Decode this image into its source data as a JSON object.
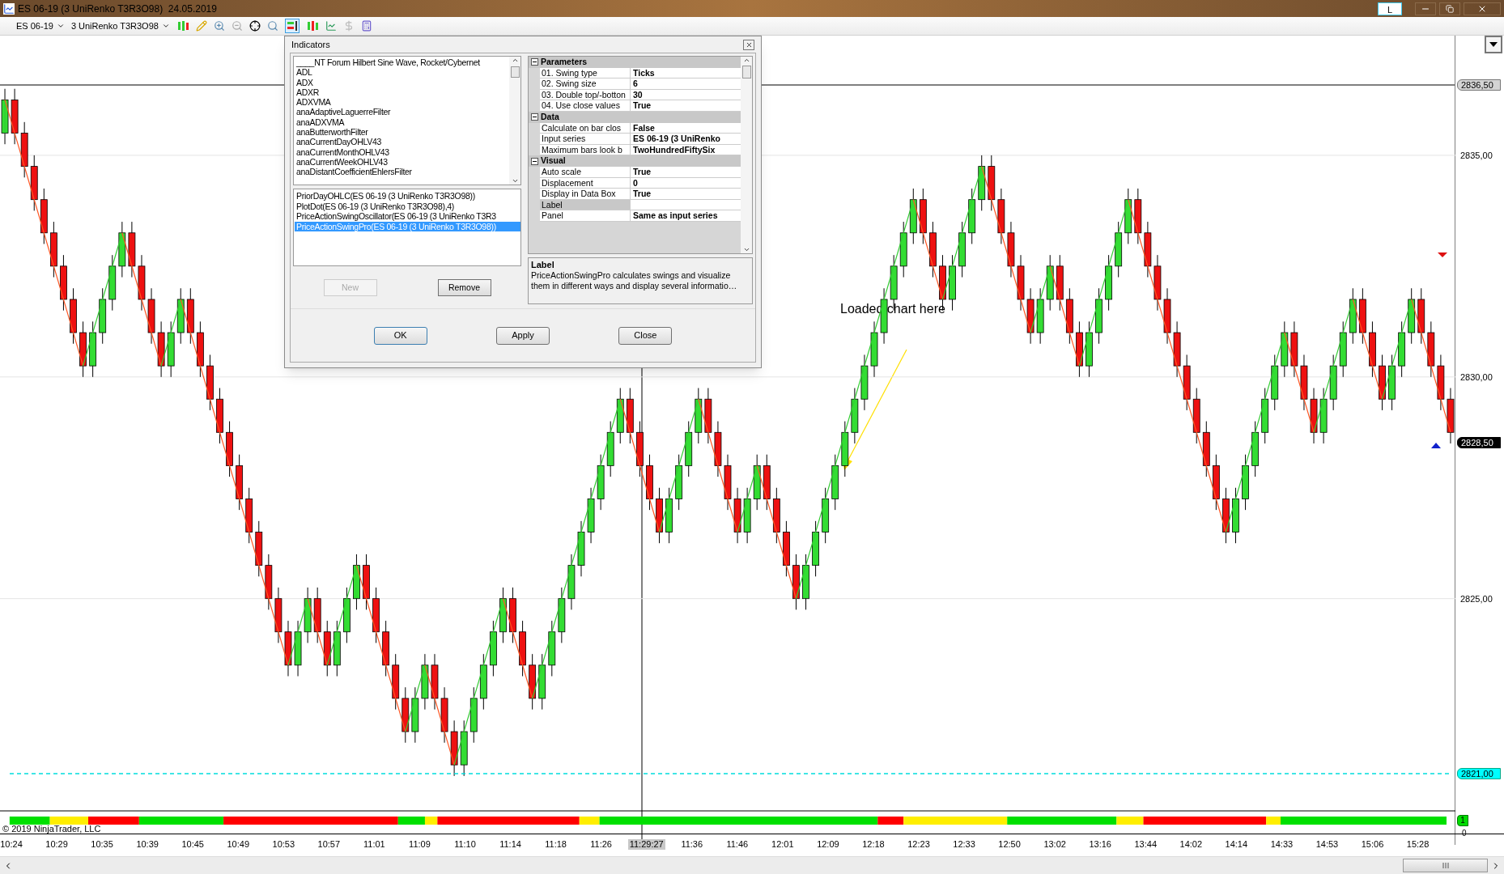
{
  "window": {
    "title": "ES 06-19 (3 UniRenko T3R3O98)  24.05.2019",
    "layout_button": "L"
  },
  "toolbar": {
    "instrument": "ES 06-19",
    "bar_type": "3 UniRenko T3R3O98"
  },
  "chart": {
    "chart_data": {
      "type": "candlestick",
      "ylim": [
        2819.5,
        2837.7
      ],
      "grid": true,
      "yticks": [
        {
          "value": 2835,
          "label": "2835,00"
        },
        {
          "value": 2830,
          "label": "2830,00"
        },
        {
          "value": 2825,
          "label": "2825,00"
        }
      ],
      "ohlc": [
        [
          2835.5,
          2836.5,
          2835.25,
          2836.25
        ],
        [
          2836.25,
          2836.5,
          2835.25,
          2835.5
        ],
        [
          2835.5,
          2835.75,
          2834.5,
          2834.75
        ],
        [
          2834.75,
          2835,
          2833.75,
          2834
        ],
        [
          2834,
          2834.25,
          2833,
          2833.25
        ],
        [
          2833.25,
          2833.5,
          2832.25,
          2832.5
        ],
        [
          2832.5,
          2832.75,
          2831.5,
          2831.75
        ],
        [
          2831.75,
          2832,
          2830.75,
          2831
        ],
        [
          2831,
          2831.25,
          2830,
          2830.25
        ],
        [
          2830.25,
          2831.25,
          2830,
          2831
        ],
        [
          2831,
          2832,
          2830.75,
          2831.75
        ],
        [
          2831.75,
          2832.75,
          2831.5,
          2832.5
        ],
        [
          2832.5,
          2833.5,
          2832.25,
          2833.25
        ],
        [
          2833.25,
          2833.5,
          2832.25,
          2832.5
        ],
        [
          2832.5,
          2832.75,
          2831.5,
          2831.75
        ],
        [
          2831.75,
          2832,
          2830.75,
          2831
        ],
        [
          2831,
          2831.25,
          2830,
          2830.25
        ],
        [
          2830.25,
          2831.25,
          2830,
          2831
        ],
        [
          2831,
          2832,
          2830.75,
          2831.75
        ],
        [
          2831.75,
          2832,
          2830.75,
          2831
        ],
        [
          2831,
          2831.25,
          2830,
          2830.25
        ],
        [
          2830.25,
          2830.5,
          2829.25,
          2829.5
        ],
        [
          2829.5,
          2829.75,
          2828.5,
          2828.75
        ],
        [
          2828.75,
          2829,
          2827.75,
          2828
        ],
        [
          2828,
          2828.25,
          2827,
          2827.25
        ],
        [
          2827.25,
          2827.5,
          2826.25,
          2826.5
        ],
        [
          2826.5,
          2826.75,
          2825.5,
          2825.75
        ],
        [
          2825.75,
          2826,
          2824.75,
          2825
        ],
        [
          2825,
          2825.25,
          2824,
          2824.25
        ],
        [
          2824.25,
          2824.5,
          2823.25,
          2823.5
        ],
        [
          2823.5,
          2824.5,
          2823.25,
          2824.25
        ],
        [
          2824.25,
          2825.25,
          2824,
          2825
        ],
        [
          2825,
          2825.25,
          2824,
          2824.25
        ],
        [
          2824.25,
          2824.5,
          2823.25,
          2823.5
        ],
        [
          2823.5,
          2824.5,
          2823.25,
          2824.25
        ],
        [
          2824.25,
          2825.25,
          2824,
          2825
        ],
        [
          2825,
          2826,
          2824.75,
          2825.75
        ],
        [
          2825.75,
          2826,
          2824.75,
          2825
        ],
        [
          2825,
          2825.25,
          2824,
          2824.25
        ],
        [
          2824.25,
          2824.5,
          2823.25,
          2823.5
        ],
        [
          2823.5,
          2823.75,
          2822.5,
          2822.75
        ],
        [
          2822.75,
          2823,
          2821.75,
          2822
        ],
        [
          2822,
          2823,
          2821.75,
          2822.75
        ],
        [
          2822.75,
          2823.75,
          2822.5,
          2823.5
        ],
        [
          2823.5,
          2823.75,
          2822.5,
          2822.75
        ],
        [
          2822.75,
          2823,
          2821.75,
          2822
        ],
        [
          2822,
          2822.25,
          2821,
          2821.25
        ],
        [
          2821.25,
          2822.25,
          2821,
          2822
        ],
        [
          2822,
          2823,
          2821.75,
          2822.75
        ],
        [
          2822.75,
          2823.75,
          2822.5,
          2823.5
        ],
        [
          2823.5,
          2824.5,
          2823.25,
          2824.25
        ],
        [
          2824.25,
          2825.25,
          2824,
          2825
        ],
        [
          2825,
          2825.25,
          2824,
          2824.25
        ],
        [
          2824.25,
          2824.5,
          2823.25,
          2823.5
        ],
        [
          2823.5,
          2823.75,
          2822.5,
          2822.75
        ],
        [
          2822.75,
          2823.75,
          2822.5,
          2823.5
        ],
        [
          2823.5,
          2824.5,
          2823.25,
          2824.25
        ],
        [
          2824.25,
          2825.25,
          2824,
          2825
        ],
        [
          2825,
          2826,
          2824.75,
          2825.75
        ],
        [
          2825.75,
          2826.75,
          2825.5,
          2826.5
        ],
        [
          2826.5,
          2827.5,
          2826.25,
          2827.25
        ],
        [
          2827.25,
          2828.25,
          2827,
          2828
        ],
        [
          2828,
          2829,
          2827.75,
          2828.75
        ],
        [
          2828.75,
          2829.75,
          2828.5,
          2829.5
        ],
        [
          2829.5,
          2829.75,
          2828.5,
          2828.75
        ],
        [
          2828.75,
          2829,
          2827.75,
          2828
        ],
        [
          2828,
          2828.25,
          2827,
          2827.25
        ],
        [
          2827.25,
          2827.5,
          2826.25,
          2826.5
        ],
        [
          2826.5,
          2827.5,
          2826.25,
          2827.25
        ],
        [
          2827.25,
          2828.25,
          2827,
          2828
        ],
        [
          2828,
          2829,
          2827.75,
          2828.75
        ],
        [
          2828.75,
          2829.75,
          2828.5,
          2829.5
        ],
        [
          2829.5,
          2829.75,
          2828.5,
          2828.75
        ],
        [
          2828.75,
          2829,
          2827.75,
          2828
        ],
        [
          2828,
          2828.25,
          2827,
          2827.25
        ],
        [
          2827.25,
          2827.5,
          2826.25,
          2826.5
        ],
        [
          2826.5,
          2827.5,
          2826.25,
          2827.25
        ],
        [
          2827.25,
          2828.25,
          2827,
          2828
        ],
        [
          2828,
          2828.25,
          2827,
          2827.25
        ],
        [
          2827.25,
          2827.5,
          2826.25,
          2826.5
        ],
        [
          2826.5,
          2826.75,
          2825.5,
          2825.75
        ],
        [
          2825.75,
          2826,
          2824.75,
          2825
        ],
        [
          2825,
          2826,
          2824.75,
          2825.75
        ],
        [
          2825.75,
          2826.75,
          2825.5,
          2826.5
        ],
        [
          2826.5,
          2827.5,
          2826.25,
          2827.25
        ],
        [
          2827.25,
          2828.25,
          2827,
          2828
        ],
        [
          2828,
          2829,
          2827.75,
          2828.75
        ],
        [
          2828.75,
          2829.75,
          2828.5,
          2829.5
        ],
        [
          2829.5,
          2830.5,
          2829.25,
          2830.25
        ],
        [
          2830.25,
          2831.25,
          2830,
          2831
        ],
        [
          2831,
          2832,
          2830.75,
          2831.75
        ],
        [
          2831.75,
          2832.75,
          2831.5,
          2832.5
        ],
        [
          2832.5,
          2833.5,
          2832.25,
          2833.25
        ],
        [
          2833.25,
          2834.25,
          2833,
          2834
        ],
        [
          2834,
          2834.25,
          2833,
          2833.25
        ],
        [
          2833.25,
          2833.5,
          2832.25,
          2832.5
        ],
        [
          2832.5,
          2832.75,
          2831.5,
          2831.75
        ],
        [
          2831.75,
          2832.75,
          2831.5,
          2832.5
        ],
        [
          2832.5,
          2833.5,
          2832.25,
          2833.25
        ],
        [
          2833.25,
          2834.25,
          2833,
          2834
        ],
        [
          2834,
          2835,
          2833.75,
          2834.75
        ],
        [
          2834.75,
          2835,
          2833.75,
          2834
        ],
        [
          2834,
          2834.25,
          2833,
          2833.25
        ],
        [
          2833.25,
          2833.5,
          2832.25,
          2832.5
        ],
        [
          2832.5,
          2832.75,
          2831.5,
          2831.75
        ],
        [
          2831.75,
          2832,
          2830.75,
          2831
        ],
        [
          2831,
          2832,
          2830.75,
          2831.75
        ],
        [
          2831.75,
          2832.75,
          2831.5,
          2832.5
        ],
        [
          2832.5,
          2832.75,
          2831.5,
          2831.75
        ],
        [
          2831.75,
          2832,
          2830.75,
          2831
        ],
        [
          2831,
          2831.25,
          2830,
          2830.25
        ],
        [
          2830.25,
          2831.25,
          2830,
          2831
        ],
        [
          2831,
          2832,
          2830.75,
          2831.75
        ],
        [
          2831.75,
          2832.75,
          2831.5,
          2832.5
        ],
        [
          2832.5,
          2833.5,
          2832.25,
          2833.25
        ],
        [
          2833.25,
          2834.25,
          2833,
          2834
        ],
        [
          2834,
          2834.25,
          2833,
          2833.25
        ],
        [
          2833.25,
          2833.5,
          2832.25,
          2832.5
        ],
        [
          2832.5,
          2832.75,
          2831.5,
          2831.75
        ],
        [
          2831.75,
          2832,
          2830.75,
          2831
        ],
        [
          2831,
          2831.25,
          2830,
          2830.25
        ],
        [
          2830.25,
          2830.5,
          2829.25,
          2829.5
        ],
        [
          2829.5,
          2829.75,
          2828.5,
          2828.75
        ],
        [
          2828.75,
          2829,
          2827.75,
          2828
        ],
        [
          2828,
          2828.25,
          2827,
          2827.25
        ],
        [
          2827.25,
          2827.5,
          2826.25,
          2826.5
        ],
        [
          2826.5,
          2827.5,
          2826.25,
          2827.25
        ],
        [
          2827.25,
          2828.25,
          2827,
          2828
        ],
        [
          2828,
          2829,
          2827.75,
          2828.75
        ],
        [
          2828.75,
          2829.75,
          2828.5,
          2829.5
        ],
        [
          2829.5,
          2830.5,
          2829.25,
          2830.25
        ],
        [
          2830.25,
          2831.25,
          2830,
          2831
        ],
        [
          2831,
          2831.25,
          2830,
          2830.25
        ],
        [
          2830.25,
          2830.5,
          2829.25,
          2829.5
        ],
        [
          2829.5,
          2829.75,
          2828.5,
          2828.75
        ],
        [
          2828.75,
          2829.75,
          2828.5,
          2829.5
        ],
        [
          2829.5,
          2830.5,
          2829.25,
          2830.25
        ],
        [
          2830.25,
          2831.25,
          2830,
          2831
        ],
        [
          2831,
          2832,
          2830.75,
          2831.75
        ],
        [
          2831.75,
          2832,
          2830.75,
          2831
        ],
        [
          2831,
          2831.25,
          2830,
          2830.25
        ],
        [
          2830.25,
          2830.5,
          2829.25,
          2829.5
        ],
        [
          2829.5,
          2830.5,
          2829.25,
          2830.25
        ],
        [
          2830.25,
          2831.25,
          2830,
          2831
        ],
        [
          2831,
          2832,
          2830.75,
          2831.75
        ],
        [
          2831.75,
          2832,
          2830.75,
          2831
        ],
        [
          2831,
          2831.25,
          2830,
          2830.25
        ],
        [
          2830.25,
          2830.5,
          2829.25,
          2829.5
        ],
        [
          2829.5,
          2829.75,
          2828.5,
          2828.75
        ]
      ]
    },
    "price_tags": [
      {
        "kind": "crosshair",
        "text": "2836,50"
      },
      {
        "kind": "last",
        "text": "2828,50"
      },
      {
        "kind": "line",
        "text": "2821,00"
      }
    ],
    "annotation": "Loaded chart here",
    "copyright": "© 2019 NinjaTrader, LLC",
    "oscillator_ticks": [
      {
        "kind": "tag",
        "text": "1"
      },
      {
        "kind": "plain",
        "text": "0"
      }
    ],
    "time_labels": [
      {
        "text": "10:24",
        "selected": false
      },
      {
        "text": "10:29",
        "selected": false
      },
      {
        "text": "10:35",
        "selected": false
      },
      {
        "text": "10:39",
        "selected": false
      },
      {
        "text": "10:45",
        "selected": false
      },
      {
        "text": "10:49",
        "selected": false
      },
      {
        "text": "10:53",
        "selected": false
      },
      {
        "text": "10:57",
        "selected": false
      },
      {
        "text": "11:01",
        "selected": false
      },
      {
        "text": "11:09",
        "selected": false
      },
      {
        "text": "11:10",
        "selected": false
      },
      {
        "text": "11:14",
        "selected": false
      },
      {
        "text": "11:18",
        "selected": false
      },
      {
        "text": "11:26",
        "selected": false
      },
      {
        "text": "11:29:27",
        "selected": true
      },
      {
        "text": "11:36",
        "selected": false
      },
      {
        "text": "11:46",
        "selected": false
      },
      {
        "text": "12:01",
        "selected": false
      },
      {
        "text": "12:09",
        "selected": false
      },
      {
        "text": "12:18",
        "selected": false
      },
      {
        "text": "12:23",
        "selected": false
      },
      {
        "text": "12:33",
        "selected": false
      },
      {
        "text": "12:50",
        "selected": false
      },
      {
        "text": "13:02",
        "selected": false
      },
      {
        "text": "13:16",
        "selected": false
      },
      {
        "text": "13:44",
        "selected": false
      },
      {
        "text": "14:02",
        "selected": false
      },
      {
        "text": "14:14",
        "selected": false
      },
      {
        "text": "14:33",
        "selected": false
      },
      {
        "text": "14:53",
        "selected": false
      },
      {
        "text": "15:06",
        "selected": false
      },
      {
        "text": "15:28",
        "selected": false
      }
    ]
  },
  "dialog": {
    "title": "Indicators",
    "available": [
      "____NT Forum Hilbert Sine Wave, Rocket/Cybernet",
      "ADL",
      "ADX",
      "ADXR",
      "ADXVMA",
      "anaAdaptiveLaguerreFilter",
      "anaADXVMA",
      "anaButterworthFilter",
      "anaCurrentDayOHLV43",
      "anaCurrentMonthOHLV43",
      "anaCurrentWeekOHLV43",
      "anaDistantCoefficientEhlersFilter"
    ],
    "applied": [
      {
        "text": "PriorDayOHLC(ES 06-19 (3 UniRenko T3R3O98))",
        "selected": false
      },
      {
        "text": "PlotDot(ES 06-19 (3 UniRenko T3R3O98),4)",
        "selected": false
      },
      {
        "text": "PriceActionSwingOscillator(ES 06-19 (3 UniRenko T3R3",
        "selected": false
      },
      {
        "text": "PriceActionSwingPro(ES 06-19 (3 UniRenko T3R3O98))",
        "selected": true
      }
    ],
    "list_buttons": [
      {
        "label": "New",
        "disabled": true
      },
      {
        "label": "Remove",
        "disabled": false
      }
    ],
    "properties": [
      {
        "category": "Parameters",
        "expanded": true,
        "rows": [
          {
            "name": "01. Swing type",
            "value": "Ticks",
            "selected": false
          },
          {
            "name": "02. Swing size",
            "value": "6",
            "selected": false
          },
          {
            "name": "03. Double top/-botton",
            "value": "30",
            "selected": false
          },
          {
            "name": "04. Use close values",
            "value": "True",
            "selected": false
          }
        ]
      },
      {
        "category": "Data",
        "expanded": true,
        "rows": [
          {
            "name": "Calculate on bar clos",
            "value": "False",
            "selected": false
          },
          {
            "name": "Input series",
            "value": "ES 06-19 (3 UniRenko",
            "selected": false
          },
          {
            "name": "Maximum bars look b",
            "value": "TwoHundredFiftySix",
            "selected": false
          }
        ]
      },
      {
        "category": "Visual",
        "expanded": true,
        "rows": [
          {
            "name": "Auto scale",
            "value": "True",
            "selected": false
          },
          {
            "name": "Displacement",
            "value": "0",
            "selected": false
          },
          {
            "name": "Display in Data Box",
            "value": "True",
            "selected": false
          },
          {
            "name": "Label",
            "value": "",
            "selected": true
          },
          {
            "name": "Panel",
            "value": "Same as input series",
            "selected": false
          }
        ]
      }
    ],
    "description": {
      "title": "Label",
      "text": "PriceActionSwingPro calculates swings and visualize them in different ways and display several informatio…"
    },
    "footer_buttons": [
      {
        "label": "OK",
        "default": true
      },
      {
        "label": "Apply",
        "default": false
      },
      {
        "label": "Close",
        "default": false
      }
    ]
  }
}
